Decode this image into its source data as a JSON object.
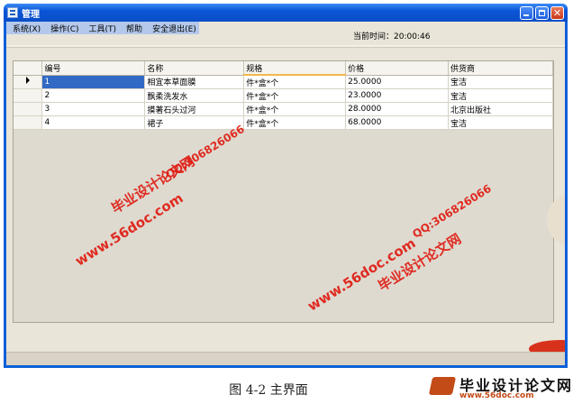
{
  "window": {
    "title": "管理",
    "icon": "app-icon",
    "controls": [
      "minimize-icon",
      "maximize-icon",
      "close-icon"
    ],
    "close_glyph": "✕",
    "accent": "#0a5fd8"
  },
  "menu": {
    "items": [
      {
        "label": "系统(X)"
      },
      {
        "label": "操作(C)"
      },
      {
        "label": "工具(T)"
      },
      {
        "label": "帮助"
      },
      {
        "label": "安全退出(E)"
      }
    ]
  },
  "clock": {
    "text": "当前时间：20:00:46"
  },
  "grid": {
    "columns": [
      "编号",
      "名称",
      "规格",
      "价格",
      "供货商"
    ],
    "rows": [
      [
        "1",
        "相宜本草面膜",
        "件*盒*个",
        "25.0000",
        "宝洁"
      ],
      [
        "2",
        "飘柔洗发水",
        "件*盒*个",
        "23.0000",
        "宝洁"
      ],
      [
        "3",
        "摸著石头过河",
        "件*盒*个",
        "28.0000",
        "北京出版社"
      ],
      [
        "4",
        "裙子",
        "件*盒*个",
        "68.0000",
        "宝洁"
      ]
    ],
    "selected_row": 0,
    "selection_color": "#316ac5"
  },
  "watermarks": {
    "site_title": "毕业设计论文网",
    "url": "www.56doc.com",
    "qq": "QQ:306826066",
    "color": "#e0190f"
  },
  "caption": "图 4-2  主界面",
  "brand": {
    "title": "毕业设计论文网",
    "url": "www.56doc.com"
  }
}
